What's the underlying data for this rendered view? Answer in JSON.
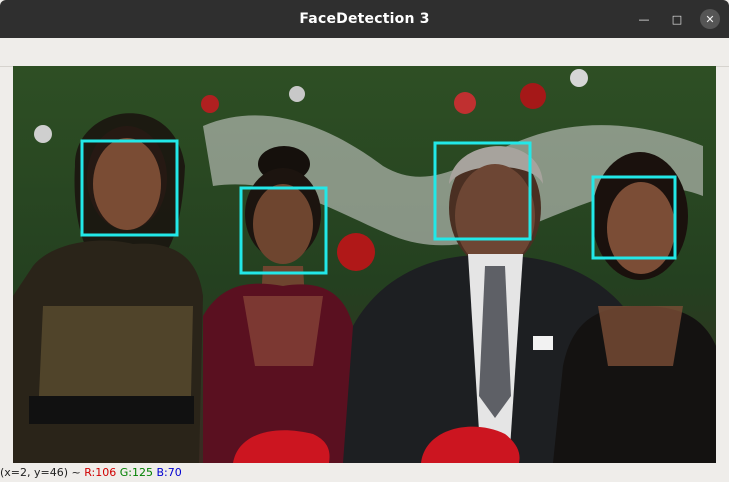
{
  "window": {
    "title": "FaceDetection 3",
    "minimize_icon": "minimize-icon",
    "maximize_icon": "maximize-icon",
    "close_icon": "close-icon"
  },
  "image": {
    "description_icon": "photo",
    "face_box_color": "#22e8e8",
    "faces_detected": 4
  },
  "status": {
    "coords": "(x=2, y=46) ~",
    "r": "R:106",
    "g": "G:125",
    "b": "B:70"
  }
}
